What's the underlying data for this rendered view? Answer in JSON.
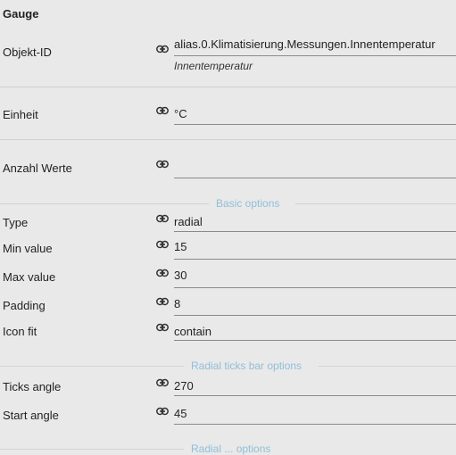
{
  "panel": {
    "title": "Gauge"
  },
  "fields": {
    "objekt_id": {
      "label": "Objekt-ID",
      "value": "alias.0.Klimatisierung.Messungen.Innentemperatur",
      "sub": "Innentemperatur"
    },
    "einheit": {
      "label": "Einheit",
      "value": "°C"
    },
    "anzahl_werte": {
      "label": "Anzahl Werte",
      "value": ""
    }
  },
  "sections": {
    "basic": "Basic options",
    "radial_ticks": "Radial ticks bar options",
    "radial_next": "Radial ... options"
  },
  "basic_options": {
    "type": {
      "label": "Type",
      "value": "radial"
    },
    "min": {
      "label": "Min value",
      "value": "15"
    },
    "max": {
      "label": "Max value",
      "value": "30"
    },
    "padding": {
      "label": "Padding",
      "value": "8"
    },
    "icon_fit": {
      "label": "Icon fit",
      "value": "contain"
    }
  },
  "radial_ticks_options": {
    "ticks_angle": {
      "label": "Ticks angle",
      "value": "270"
    },
    "start_angle": {
      "label": "Start angle",
      "value": "45"
    }
  },
  "icons": {
    "link": "link-icon"
  }
}
